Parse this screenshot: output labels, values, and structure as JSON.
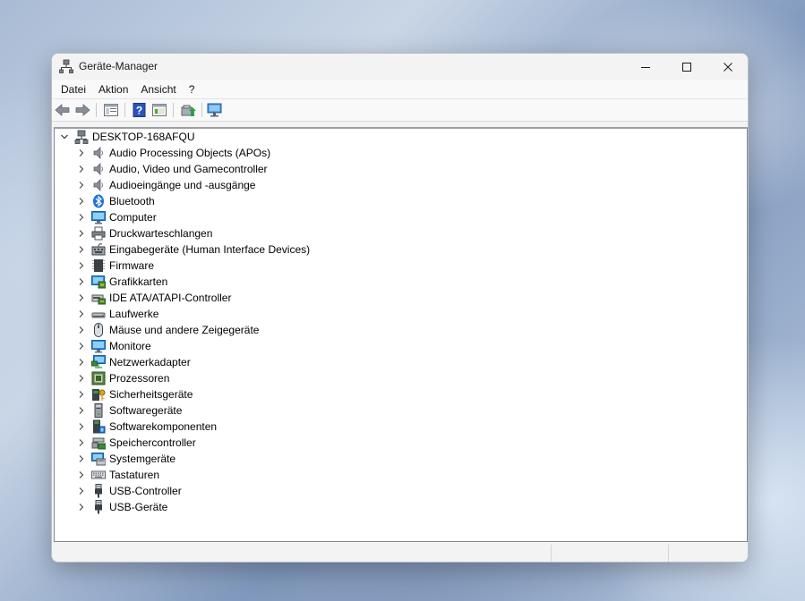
{
  "window": {
    "title": "Geräte-Manager"
  },
  "menu": {
    "items": [
      "Datei",
      "Aktion",
      "Ansicht",
      "?"
    ]
  },
  "toolbar": {
    "buttons": [
      "back-icon",
      "forward-icon",
      "show-hide-console-tree-icon",
      "help-icon",
      "properties-icon",
      "update-driver-icon",
      "scan-hardware-icon"
    ]
  },
  "tree": {
    "root": "DESKTOP-168AFQU",
    "items": [
      "Audio Processing Objects (APOs)",
      "Audio, Video und Gamecontroller",
      "Audioeingänge und -ausgänge",
      "Bluetooth",
      "Computer",
      "Druckwarteschlangen",
      "Eingabegeräte (Human Interface Devices)",
      "Firmware",
      "Grafikkarten",
      "IDE ATA/ATAPI-Controller",
      "Laufwerke",
      "Mäuse und andere Zeigegeräte",
      "Monitore",
      "Netzwerkadapter",
      "Prozessoren",
      "Sicherheitsgeräte",
      "Softwaregeräte",
      "Softwarekomponenten",
      "Speichercontroller",
      "Systemgeräte",
      "Tastaturen",
      "USB-Controller",
      "USB-Geräte"
    ],
    "icons": [
      "speaker-icon",
      "speaker-icon",
      "speaker-icon",
      "bluetooth-icon",
      "computer-icon",
      "printer-icon",
      "hid-icon",
      "firmware-chip-icon",
      "display-adapter-icon",
      "ide-controller-icon",
      "drive-icon",
      "mouse-icon",
      "monitor-icon",
      "network-adapter-icon",
      "processor-icon",
      "security-device-icon",
      "software-device-icon",
      "software-component-icon",
      "storage-controller-icon",
      "system-device-icon",
      "keyboard-icon",
      "usb-icon",
      "usb-icon"
    ]
  },
  "colors": {
    "accent": "#0078d4",
    "tree_background": "#ffffff",
    "window_background": "#f3f3f3"
  }
}
